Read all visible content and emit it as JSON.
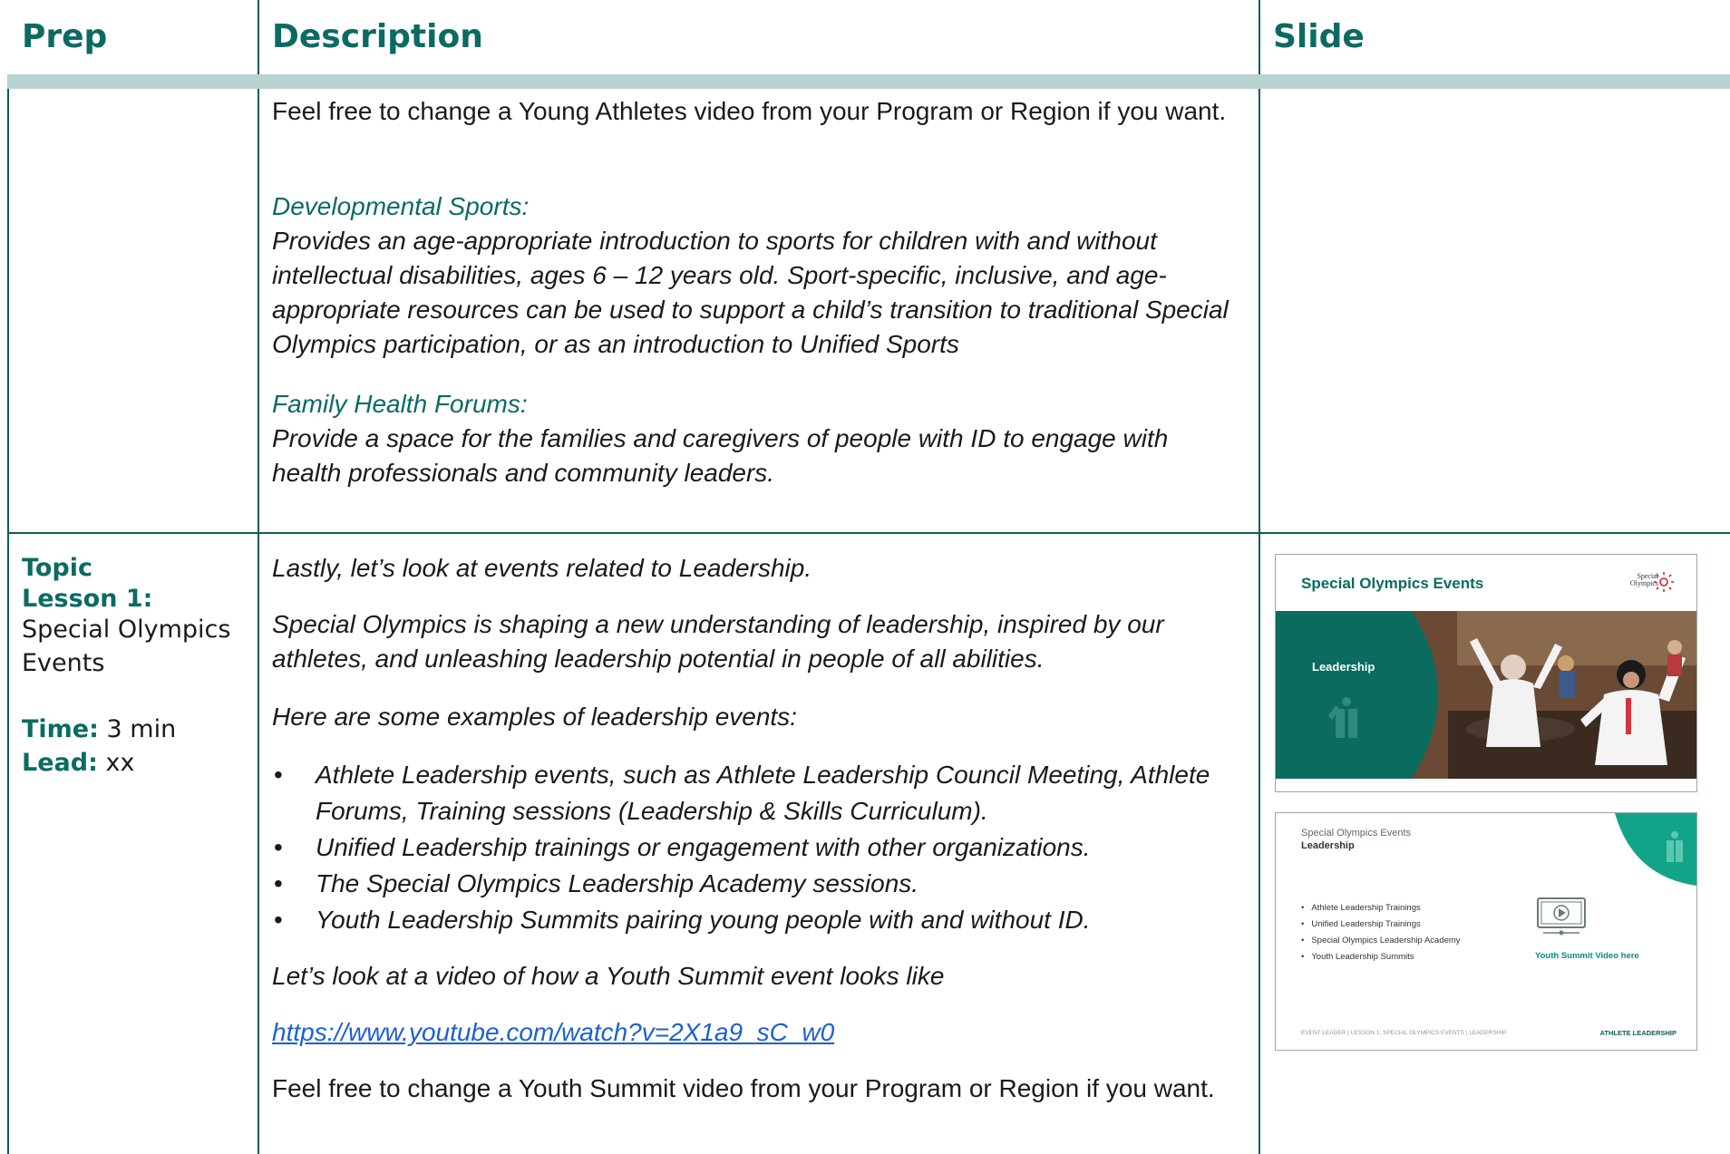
{
  "header": {
    "prep": "Prep",
    "description": "Description",
    "slide": "Slide"
  },
  "row1": {
    "intro": "Feel free to change a Young Athletes video from your Program or Region if you want.",
    "dev_title": "Developmental Sports:",
    "dev_body": "Provides an age-appropriate introduction to sports for children with and without intellectual disabilities, ages 6 – 12 years old. Sport-specific, inclusive, and age-appropriate resources can be used to support a child’s transition to traditional Special Olympics participation, or as an introduction to Unified Sports",
    "fhf_title": "Family Health Forums:",
    "fhf_body": "Provide a space for the families and caregivers of people with ID to engage with health professionals and community leaders."
  },
  "row2": {
    "prep": {
      "topic_label": "Topic",
      "lesson_label": "Lesson 1:",
      "lesson_value": "Special Olympics Events",
      "time_label": "Time:",
      "time_value": "3 min",
      "lead_label": "Lead:",
      "lead_value": "xx"
    },
    "lastly": "Lastly, let’s look at events related to Leadership.",
    "shaping": "Special Olympics is shaping a new understanding of leadership,  inspired by our athletes, and unleashing leadership potential in people of all abilities.",
    "examples_intro": "Here are some examples of leadership events:",
    "bullets": [
      "Athlete Leadership events, such as Athlete Leadership Council Meeting, Athlete Forums, Training sessions (Leadership & Skills Curriculum).",
      "Unified Leadership trainings or engagement with other organizations.",
      "The Special Olympics Leadership Academy sessions.",
      "Youth Leadership Summits pairing young people with and without ID."
    ],
    "video_intro": "Let’s look at a video of how a Youth Summit event looks like",
    "video_link": "https://www.youtube.com/watch?v=2X1a9_sC_w0",
    "outro": "Feel free to change a Youth Summit video from your Program or Region if you want."
  },
  "slide1": {
    "title": "Special Olympics Events",
    "logo_text": "Special Olympics",
    "label": "Leadership"
  },
  "slide2": {
    "title": "Special Olympics Events",
    "subtitle": "Leadership",
    "items": [
      "Athlete Leadership Trainings",
      "Unified Leadership Trainings",
      "Special Olympics Leadership Academy",
      "Youth Leadership Summits"
    ],
    "video_label": "Youth Summit Video here",
    "footer_left": "EVENT LEADER | LESSON 1: SPECIAL OLYMPICS EVENTS | LEADERSHIP",
    "footer_right": "ATHLETE LEADERSHIP"
  },
  "colors": {
    "teal": "#0b6b63",
    "rule": "#0b5d57",
    "band": "#b9d3d1",
    "link": "#1b5fd6"
  }
}
